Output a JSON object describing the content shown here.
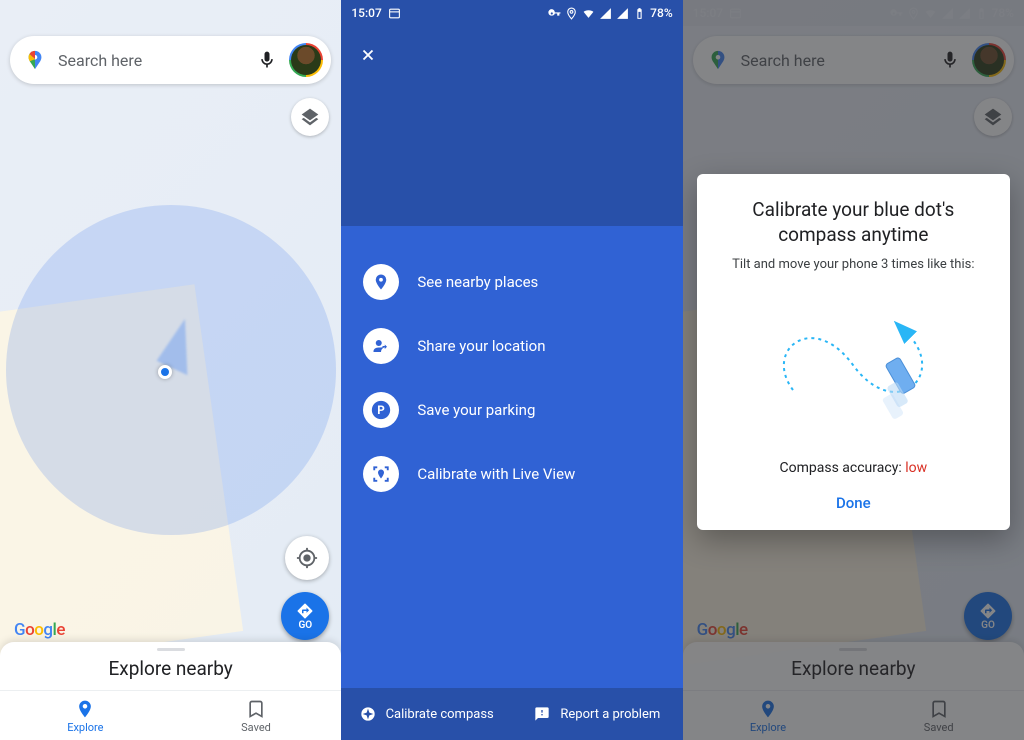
{
  "status": {
    "time": "15:07",
    "battery": "78%"
  },
  "screen1": {
    "search_placeholder": "Search here",
    "layers_label": "Layers",
    "go_label": "GO",
    "google": "Google",
    "sheet_title": "Explore nearby",
    "nav": {
      "explore": "Explore",
      "saved": "Saved"
    }
  },
  "screen2": {
    "menu": {
      "nearby": "See nearby places",
      "share": "Share your location",
      "parking": "Save your parking",
      "liveview": "Calibrate with Live View"
    },
    "footer": {
      "calibrate": "Calibrate compass",
      "report": "Report a problem"
    }
  },
  "screen3": {
    "dialog_title": "Calibrate your blue dot's compass anytime",
    "dialog_sub": "Tilt and move your phone 3 times like this:",
    "accuracy_label": "Compass accuracy: ",
    "accuracy_value": "low",
    "done": "Done"
  }
}
